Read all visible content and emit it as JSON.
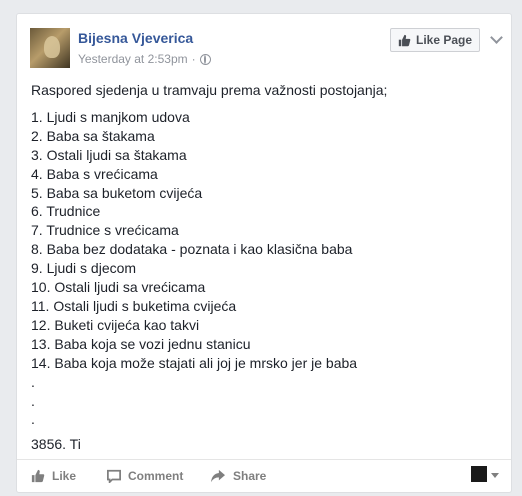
{
  "post": {
    "author": "Bijesna Vjeverica",
    "timestamp": "Yesterday at 2:53pm",
    "separator": "·",
    "like_page_label": "Like Page",
    "intro": "Raspored sjedenja u tramvaju prema važnosti postojanja;",
    "items": [
      "1. Ljudi s manjkom udova",
      "2. Baba sa štakama",
      "3. Ostali ljudi sa štakama",
      "4. Baba s vrećicama",
      "5. Baba sa buketom cvijeća",
      "6. Trudnice",
      "7. Trudnice s vrećicama",
      "8. Baba bez dodataka - poznata i kao klasična baba",
      "9. Ljudi s djecom",
      "10. Ostali ljudi sa vrećicama",
      "11. Ostali ljudi s buketima cvijeća",
      "12. Buketi cvijeća kao takvi",
      "13. Baba koja se vozi jednu stanicu",
      "14. Baba koja može stajati ali joj je mrsko jer je baba"
    ],
    "dots": [
      ".",
      ".",
      "."
    ],
    "last_line": "3856. Ti"
  },
  "actions": {
    "like": "Like",
    "comment": "Comment",
    "share": "Share"
  },
  "icons": [
    "thumbs-up-icon",
    "globe-icon",
    "chevron-down-icon",
    "comment-icon",
    "share-icon",
    "caret-down-icon"
  ]
}
